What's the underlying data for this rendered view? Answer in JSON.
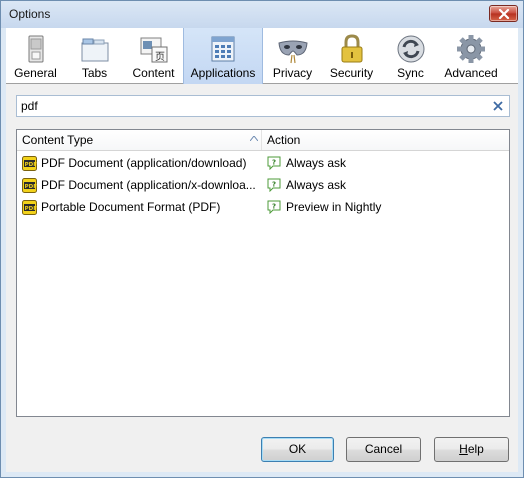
{
  "window": {
    "title": "Options"
  },
  "toolbar": {
    "panes": [
      {
        "label": "General",
        "icon": "general-icon"
      },
      {
        "label": "Tabs",
        "icon": "tabs-icon"
      },
      {
        "label": "Content",
        "icon": "content-icon"
      },
      {
        "label": "Applications",
        "icon": "applications-icon",
        "selected": true
      },
      {
        "label": "Privacy",
        "icon": "privacy-mask-icon"
      },
      {
        "label": "Security",
        "icon": "padlock-icon"
      },
      {
        "label": "Sync",
        "icon": "sync-icon"
      },
      {
        "label": "Advanced",
        "icon": "gear-icon"
      }
    ]
  },
  "search": {
    "value": "pdf"
  },
  "table": {
    "columns": {
      "content_type": "Content Type",
      "action": "Action"
    },
    "rows": [
      {
        "content_type": "PDF Document (application/download)",
        "action": "Always ask"
      },
      {
        "content_type": "PDF Document (application/x-downloa...",
        "action": "Always ask"
      },
      {
        "content_type": "Portable Document Format (PDF)",
        "action": "Preview in Nightly"
      }
    ]
  },
  "buttons": {
    "ok": "OK",
    "cancel": "Cancel",
    "help_mnemonic": "H",
    "help_rest": "elp"
  },
  "colors": {
    "selected_pane": "#c3d7f3",
    "title_bar": "#c7d8ee",
    "close_button": "#c8483a"
  }
}
